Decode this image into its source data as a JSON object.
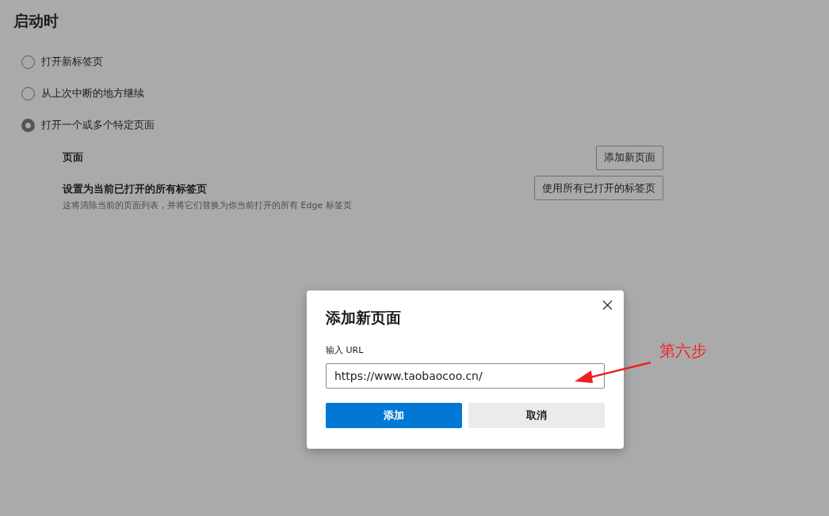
{
  "section_title": "启动时",
  "startup_options": [
    {
      "label": "打开新标签页",
      "selected": false
    },
    {
      "label": "从上次中断的地方继续",
      "selected": false
    },
    {
      "label": "打开一个或多个特定页面",
      "selected": true
    }
  ],
  "pages_row": {
    "label": "页面",
    "button": "添加新页面"
  },
  "set_current_row": {
    "label": "设置为当前已打开的所有标签页",
    "description": "这将清除当前的页面列表，并将它们替换为你当前打开的所有 Edge 标签页",
    "button": "使用所有已打开的标签页"
  },
  "dialog": {
    "title": "添加新页面",
    "field_label": "输入 URL",
    "url_value": "https://www.taobaocoo.cn/",
    "buttons": [
      {
        "label": "添加",
        "kind": "primary"
      },
      {
        "label": "取消",
        "kind": "secondary"
      }
    ]
  },
  "annotation": {
    "text": "第六步"
  }
}
